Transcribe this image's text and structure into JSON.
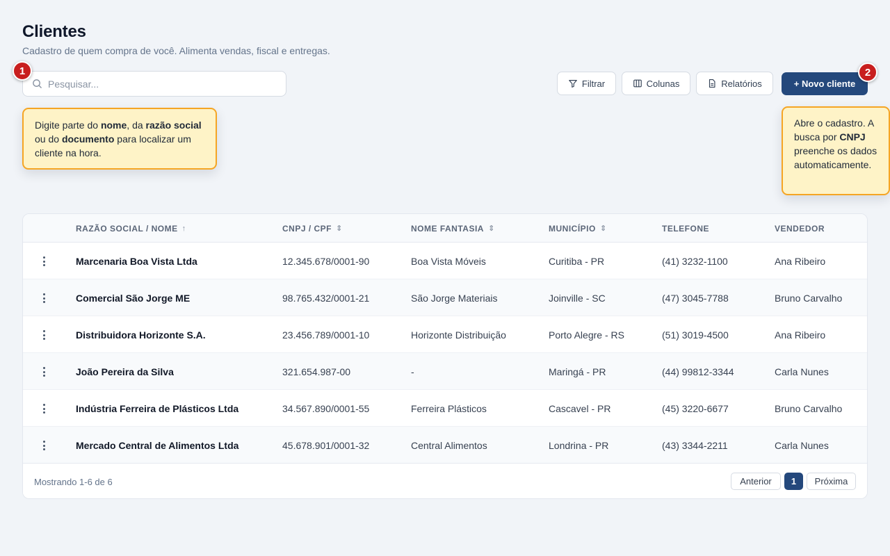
{
  "header": {
    "title": "Clientes",
    "subtitle": "Cadastro de quem compra de você. Alimenta vendas, fiscal e entregas."
  },
  "search": {
    "placeholder": "Pesquisar...",
    "value": ""
  },
  "toolbar": {
    "filter_label": "Filtrar",
    "columns_label": "Colunas",
    "reports_label": "Relatórios",
    "new_label": "+ Novo cliente"
  },
  "markers": [
    "1",
    "2"
  ],
  "tooltips": {
    "search": {
      "t1": "Digite parte do ",
      "b1": "nome",
      "t2": ", da ",
      "b2": "razão social",
      "t3": " ou do ",
      "b3": "documento",
      "t4": " para localizar um cliente na hora."
    },
    "new": {
      "t1": "Abre o cadastro. A busca por ",
      "b1": "CNPJ",
      "t2": " preenche os dados automaticamente."
    }
  },
  "table": {
    "columns": [
      {
        "label": "RAZÃO SOCIAL / NOME",
        "sort": "↑"
      },
      {
        "label": "CNPJ / CPF",
        "sort": "⇕"
      },
      {
        "label": "NOME FANTASIA",
        "sort": "⇕"
      },
      {
        "label": "MUNICÍPIO",
        "sort": "⇕"
      },
      {
        "label": "TELEFONE",
        "sort": ""
      },
      {
        "label": "VENDEDOR",
        "sort": ""
      }
    ],
    "rows": [
      [
        "Marcenaria Boa Vista Ltda",
        "12.345.678/0001-90",
        "Boa Vista Móveis",
        "Curitiba - PR",
        "(41) 3232-1100",
        "Ana Ribeiro"
      ],
      [
        "Comercial São Jorge ME",
        "98.765.432/0001-21",
        "São Jorge Materiais",
        "Joinville - SC",
        "(47) 3045-7788",
        "Bruno Carvalho"
      ],
      [
        "Distribuidora Horizonte S.A.",
        "23.456.789/0001-10",
        "Horizonte Distribuição",
        "Porto Alegre - RS",
        "(51) 3019-4500",
        "Ana Ribeiro"
      ],
      [
        "João Pereira da Silva",
        "321.654.987-00",
        "-",
        "Maringá - PR",
        "(44) 99812-3344",
        "Carla Nunes"
      ],
      [
        "Indústria Ferreira de Plásticos Ltda",
        "34.567.890/0001-55",
        "Ferreira Plásticos",
        "Cascavel - PR",
        "(45) 3220-6677",
        "Bruno Carvalho"
      ],
      [
        "Mercado Central de Alimentos Ltda",
        "45.678.901/0001-32",
        "Central Alimentos",
        "Londrina - PR",
        "(43) 3344-2211",
        "Carla Nunes"
      ]
    ]
  },
  "pagination": {
    "showing": "Mostrando 1-6 de 6",
    "prev_label": "Anterior",
    "current_page": "1",
    "next_label": "Próxima"
  },
  "colors": {
    "primary": "#24487c",
    "marker": "#c81e1e",
    "tooltip_bg": "#fef3c7",
    "tooltip_border": "#f5a524"
  }
}
